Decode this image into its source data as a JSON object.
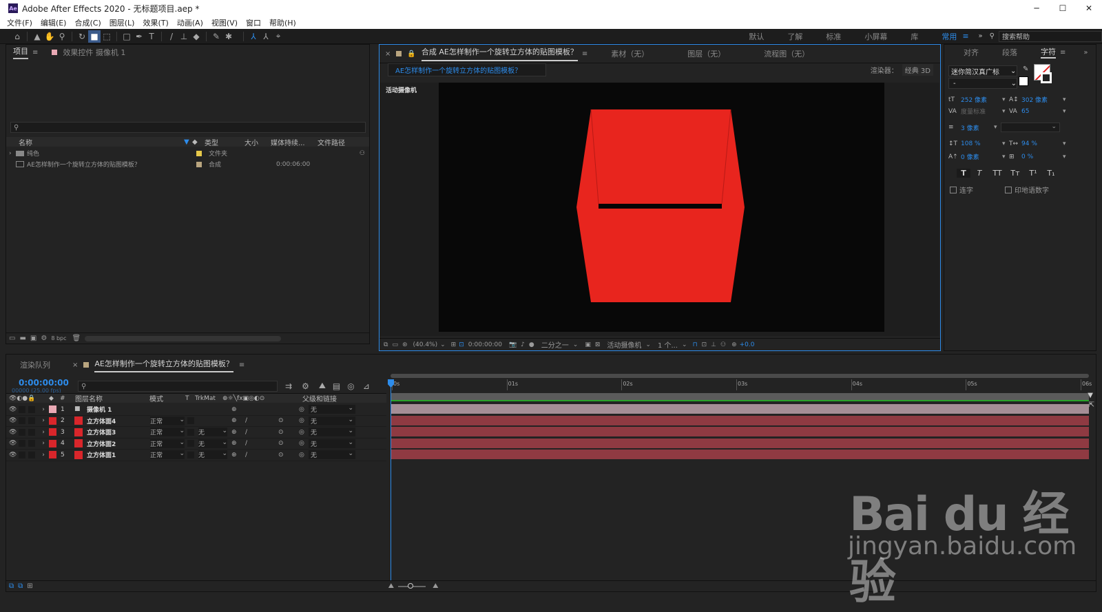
{
  "window": {
    "app_icon": "Ae",
    "title": "Adobe After Effects 2020 - 无标题项目.aep *",
    "min": "─",
    "max": "☐",
    "close": "✕"
  },
  "menu": [
    "文件(F)",
    "编辑(E)",
    "合成(C)",
    "图层(L)",
    "效果(T)",
    "动画(A)",
    "视图(V)",
    "窗口",
    "帮助(H)"
  ],
  "workspaces": [
    "默认",
    "了解",
    "标准",
    "小屏幕",
    "库",
    "常用"
  ],
  "search_help": "搜索帮助",
  "project": {
    "tabs": [
      "项目",
      "效果控件 摄像机 1"
    ],
    "columns": [
      "名称",
      "类型",
      "大小",
      "媒体持续...",
      "文件路径"
    ],
    "items": [
      {
        "name": "纯色",
        "type": "文件夹",
        "duration": "",
        "color": "#e6c84a"
      },
      {
        "name": "AE怎样制作一个旋转立方体的贴图模板？",
        "type": "合成",
        "duration": "0:00:06:00",
        "color": "#b9a57f"
      }
    ],
    "bpc": "8 bpc"
  },
  "comp": {
    "tabs": [
      "合成 AE怎样制作一个旋转立方体的贴图模板？",
      "素材（无）",
      "图层（无）",
      "流程图（无）"
    ],
    "breadcrumb": "AE怎样制作一个旋转立方体的贴图模板？",
    "renderer_label": "渲染器：",
    "renderer": "经典 3D",
    "camera_label": "活动摄像机",
    "zoom": "(40.4%)",
    "time": "0:00:00:00",
    "resolution": "二分之一",
    "view": "活动摄像机",
    "views": "1 个...",
    "exposure": "+0.0",
    "cube_color": "#e8251e"
  },
  "character": {
    "tabs": [
      "对齐",
      "段落",
      "字符"
    ],
    "font": "迷你简汉真广标",
    "style": "-",
    "size": "252 像素",
    "leading": "302 像素",
    "kerning": "度量标准",
    "tracking": "65",
    "stroke": "3 像素",
    "vscale": "108 %",
    "hscale": "94 %",
    "baseline": "0 像素",
    "tsume": "0 %",
    "styles": [
      "T",
      "T",
      "TT",
      "Tт",
      "T¹",
      "T₁"
    ],
    "ligatures": "连字",
    "hindi": "印地语数字"
  },
  "timeline": {
    "tabs": [
      "渲染队列",
      "AE怎样制作一个旋转立方体的贴图模板？"
    ],
    "timecode": "0:00:00:00",
    "fps": "00000 (25.00 fps)",
    "headers": {
      "name": "图层名称",
      "mode": "模式",
      "t": "T",
      "trkmat": "TrkMat",
      "parent": "父级和链接"
    },
    "ruler": [
      "0s",
      "01s",
      "02s",
      "03s",
      "04s",
      "05s",
      "06s"
    ],
    "layers": [
      {
        "num": "1",
        "name": "摄像机 1",
        "mode": "",
        "trkmat": "",
        "parent": "无",
        "color": "#e9a9b4",
        "camera": true
      },
      {
        "num": "2",
        "name": "立方体面4",
        "mode": "正常",
        "trkmat": "",
        "parent": "无",
        "color": "#d9262b",
        "camera": false
      },
      {
        "num": "3",
        "name": "立方体面3",
        "mode": "正常",
        "trkmat": "无",
        "parent": "无",
        "color": "#d9262b",
        "camera": false
      },
      {
        "num": "4",
        "name": "立方体面2",
        "mode": "正常",
        "trkmat": "无",
        "parent": "无",
        "color": "#d9262b",
        "camera": false
      },
      {
        "num": "5",
        "name": "立方体面1",
        "mode": "正常",
        "trkmat": "无",
        "parent": "无",
        "color": "#d9262b",
        "camera": false
      }
    ]
  },
  "watermark": {
    "brand": "Bai du 经验",
    "url": "jingyan.baidu.com"
  },
  "colors": {
    "accent": "#2d8ceb",
    "camera_bar": "#a58e96",
    "solid_bar": "#8f3a42"
  }
}
